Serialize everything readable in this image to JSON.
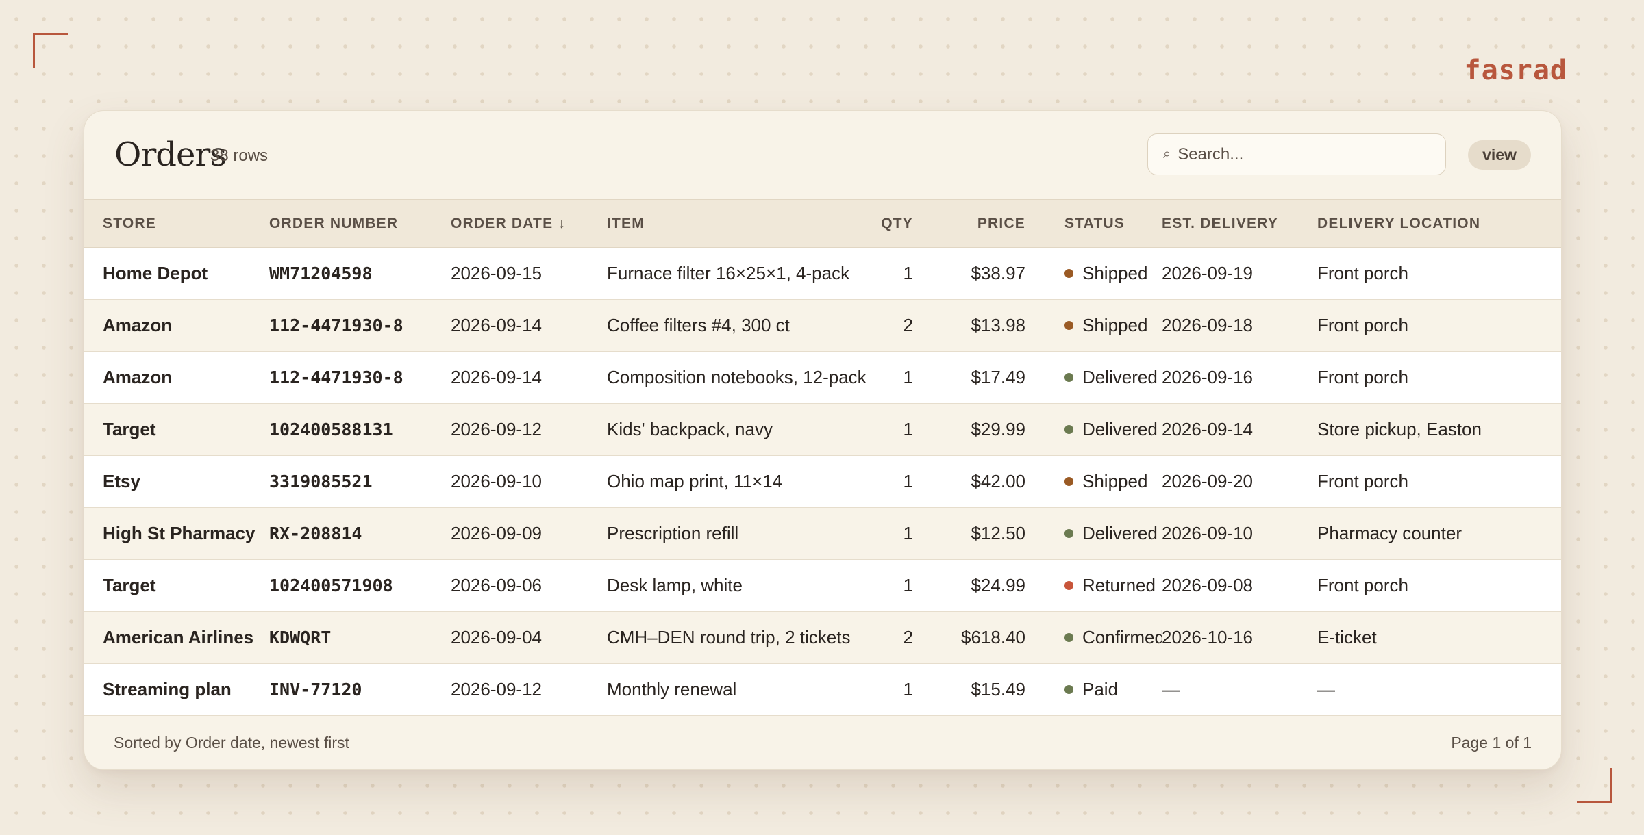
{
  "brand": "fasrad",
  "table": {
    "title": "Orders",
    "row_count": "38 rows",
    "search": {
      "placeholder": "Search..."
    },
    "view_label": "view",
    "columns": {
      "store": "STORE",
      "order_number": "ORDER NUMBER",
      "order_date": "ORDER DATE ↓",
      "item": "ITEM",
      "qty": "QTY",
      "price": "PRICE",
      "status": "STATUS",
      "est_delivery": "EST. DELIVERY",
      "location": "DELIVERY LOCATION"
    },
    "rows": [
      {
        "store": "Home Depot",
        "order_number": "WM71204598",
        "order_date": "2026-09-15",
        "item": "Furnace filter 16×25×1, 4-pack",
        "qty": "1",
        "price": "$38.97",
        "status": "Shipped",
        "est_delivery": "2026-09-19",
        "location": "Front porch"
      },
      {
        "store": "Amazon",
        "order_number": "112-4471930-8",
        "order_date": "2026-09-14",
        "item": "Coffee filters #4, 300 ct",
        "qty": "2",
        "price": "$13.98",
        "status": "Shipped",
        "est_delivery": "2026-09-18",
        "location": "Front porch"
      },
      {
        "store": "Amazon",
        "order_number": "112-4471930-8",
        "order_date": "2026-09-14",
        "item": "Composition notebooks, 12-pack",
        "qty": "1",
        "price": "$17.49",
        "status": "Delivered",
        "est_delivery": "2026-09-16",
        "location": "Front porch"
      },
      {
        "store": "Target",
        "order_number": "102400588131",
        "order_date": "2026-09-12",
        "item": "Kids' backpack, navy",
        "qty": "1",
        "price": "$29.99",
        "status": "Delivered",
        "est_delivery": "2026-09-14",
        "location": "Store pickup, Easton"
      },
      {
        "store": "Etsy",
        "order_number": "3319085521",
        "order_date": "2026-09-10",
        "item": "Ohio map print, 11×14",
        "qty": "1",
        "price": "$42.00",
        "status": "Shipped",
        "est_delivery": "2026-09-20",
        "location": "Front porch"
      },
      {
        "store": "High St Pharmacy",
        "order_number": "RX-208814",
        "order_date": "2026-09-09",
        "item": "Prescription refill",
        "qty": "1",
        "price": "$12.50",
        "status": "Delivered",
        "est_delivery": "2026-09-10",
        "location": "Pharmacy counter"
      },
      {
        "store": "Target",
        "order_number": "102400571908",
        "order_date": "2026-09-06",
        "item": "Desk lamp, white",
        "qty": "1",
        "price": "$24.99",
        "status": "Returned",
        "est_delivery": "2026-09-08",
        "location": "Front porch"
      },
      {
        "store": "American Airlines",
        "order_number": "KDWQRT",
        "order_date": "2026-09-04",
        "item": "CMH–DEN round trip, 2 tickets",
        "qty": "2",
        "price": "$618.40",
        "status": "Confirmed",
        "est_delivery": "2026-10-16",
        "location": "E-ticket"
      },
      {
        "store": "Streaming plan",
        "order_number": "INV-77120",
        "order_date": "2026-09-12",
        "item": "Monthly renewal",
        "qty": "1",
        "price": "$15.49",
        "status": "Paid",
        "est_delivery": "—",
        "location": "—"
      }
    ],
    "footer": {
      "sort_note": "Sorted by Order date, newest first",
      "page": "Page 1 of 1"
    }
  },
  "status_colors": {
    "Shipped": "#9a5a24",
    "Delivered": "#6b7a50",
    "Returned": "#c8553a",
    "Confirmed": "#6b7a50",
    "Paid": "#6b7a50"
  },
  "icons": {
    "search": "search-icon"
  }
}
